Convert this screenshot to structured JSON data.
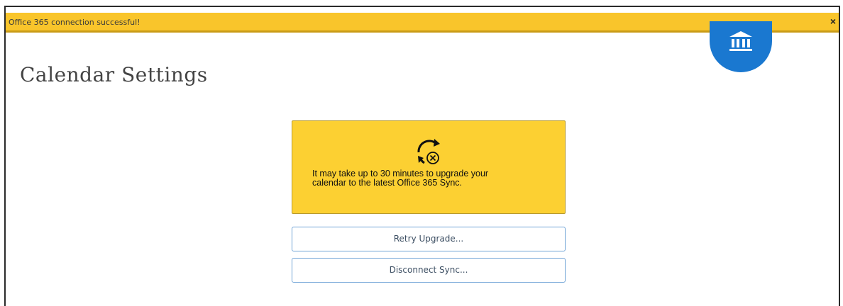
{
  "banner": {
    "message": "Office 365 connection successful!",
    "close_label": "×"
  },
  "logo": {
    "icon": "institution-icon",
    "color": "#1a78d0"
  },
  "page": {
    "title": "Calendar Settings"
  },
  "notice": {
    "icon": "sync-error-icon",
    "line1": "It may take up to 30 minutes to upgrade your",
    "line2": "calendar to the latest Office 365 Sync.",
    "background": "#fcd032"
  },
  "actions": {
    "retry_label": "Retry Upgrade...",
    "disconnect_label": "Disconnect Sync..."
  },
  "colors": {
    "banner": "#f9c52b",
    "button_border": "#6fa3d6"
  }
}
